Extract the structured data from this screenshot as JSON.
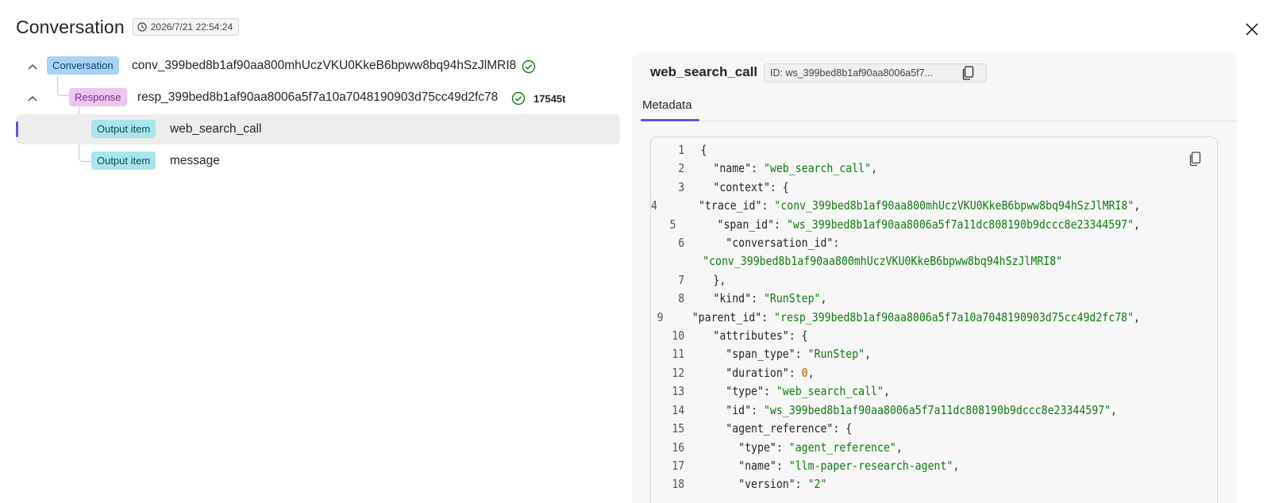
{
  "header": {
    "title": "Conversation",
    "timestamp": "2026/7/21 22:54:24"
  },
  "tree": {
    "conversation": {
      "badge": "Conversation",
      "label": "conv_399bed8b1af90aa800mhUczVKU0KkeB6bpww8bq94hSzJlMRI8"
    },
    "response": {
      "badge": "Response",
      "label": "resp_399bed8b1af90aa8006a5f7a10a7048190903d75cc49d2fc78",
      "tokens": "17545t"
    },
    "outputs": [
      {
        "badge": "Output item",
        "label": "web_search_call",
        "selected": true
      },
      {
        "badge": "Output item",
        "label": "message",
        "selected": false
      }
    ]
  },
  "panel": {
    "title": "web_search_call",
    "id_chip": "ID: ws_399bed8b1af90aa8006a5f7...",
    "tabs": [
      "Metadata"
    ],
    "code_lines": [
      [
        "1",
        [
          [
            "k",
            "{"
          ]
        ]
      ],
      [
        "2",
        [
          [
            "k",
            "  \"name\": "
          ],
          [
            "s",
            "\"web_search_call\""
          ],
          [
            "k",
            ","
          ]
        ]
      ],
      [
        "3",
        [
          [
            "k",
            "  \"context\": {"
          ]
        ]
      ],
      [
        "4",
        [
          [
            "k",
            "    \"trace_id\": "
          ],
          [
            "s",
            "\"conv_399bed8b1af90aa800mhUczVKU0KkeB6bpww8bq94hSzJlMRI8\""
          ],
          [
            "k",
            ","
          ]
        ]
      ],
      [
        "5",
        [
          [
            "k",
            "    \"span_id\": "
          ],
          [
            "s",
            "\"ws_399bed8b1af90aa8006a5f7a11dc808190b9dccc8e23344597\""
          ],
          [
            "k",
            ","
          ]
        ]
      ],
      [
        "6",
        [
          [
            "k",
            "    \"conversation_id\":"
          ]
        ]
      ],
      [
        "",
        [
          [
            "s",
            "\"conv_399bed8b1af90aa800mhUczVKU0KkeB6bpww8bq94hSzJlMRI8\""
          ]
        ]
      ],
      [
        "7",
        [
          [
            "k",
            "  },"
          ]
        ]
      ],
      [
        "8",
        [
          [
            "k",
            "  \"kind\": "
          ],
          [
            "s",
            "\"RunStep\""
          ],
          [
            "k",
            ","
          ]
        ]
      ],
      [
        "9",
        [
          [
            "k",
            "  \"parent_id\": "
          ],
          [
            "s",
            "\"resp_399bed8b1af90aa8006a5f7a10a7048190903d75cc49d2fc78\""
          ],
          [
            "k",
            ","
          ]
        ]
      ],
      [
        "10",
        [
          [
            "k",
            "  \"attributes\": {"
          ]
        ]
      ],
      [
        "11",
        [
          [
            "k",
            "    \"span_type\": "
          ],
          [
            "s",
            "\"RunStep\""
          ],
          [
            "k",
            ","
          ]
        ]
      ],
      [
        "12",
        [
          [
            "k",
            "    \"duration\": "
          ],
          [
            "n",
            "0"
          ],
          [
            "k",
            ","
          ]
        ]
      ],
      [
        "13",
        [
          [
            "k",
            "    \"type\": "
          ],
          [
            "s",
            "\"web_search_call\""
          ],
          [
            "k",
            ","
          ]
        ]
      ],
      [
        "14",
        [
          [
            "k",
            "    \"id\": "
          ],
          [
            "s",
            "\"ws_399bed8b1af90aa8006a5f7a11dc808190b9dccc8e23344597\""
          ],
          [
            "k",
            ","
          ]
        ]
      ],
      [
        "15",
        [
          [
            "k",
            "    \"agent_reference\": {"
          ]
        ]
      ],
      [
        "16",
        [
          [
            "k",
            "      \"type\": "
          ],
          [
            "s",
            "\"agent_reference\""
          ],
          [
            "k",
            ","
          ]
        ]
      ],
      [
        "17",
        [
          [
            "k",
            "      \"name\": "
          ],
          [
            "s",
            "\"llm-paper-research-agent\""
          ],
          [
            "k",
            ","
          ]
        ]
      ],
      [
        "18",
        [
          [
            "k",
            "      \"version\": "
          ],
          [
            "s",
            "\"2\""
          ]
        ]
      ]
    ]
  },
  "colors": {
    "accent": "#6c4dd6",
    "success": "#107c10",
    "string": "#0f7b0f",
    "number": "#b35a00"
  },
  "icons": {
    "close": "close-icon",
    "clock": "clock-icon",
    "check": "check-circle-icon",
    "chevron": "chevron-up-icon",
    "copy": "copy-icon"
  }
}
